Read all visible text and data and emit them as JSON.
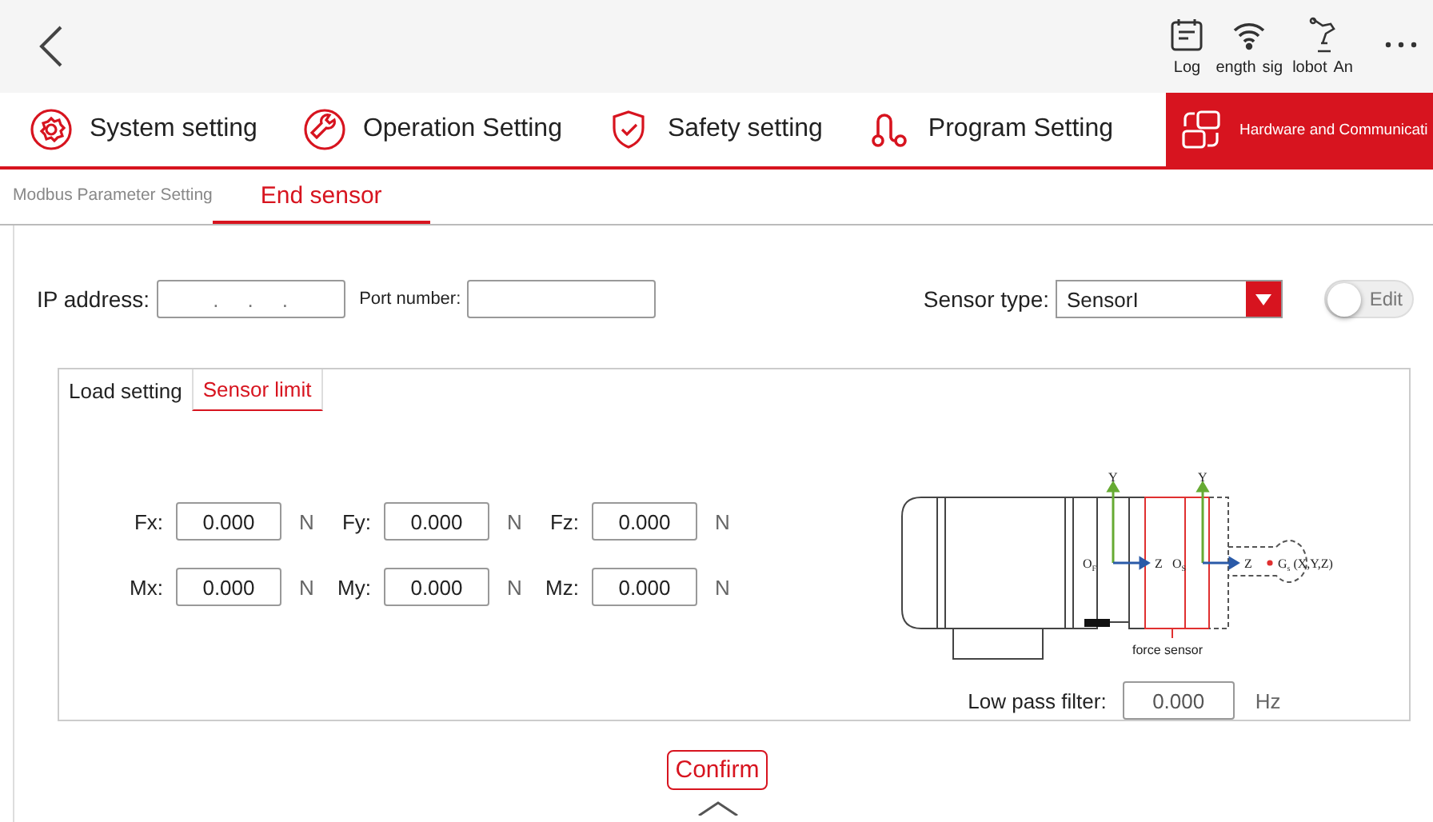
{
  "top_bar": {
    "status_items": [
      {
        "kind": "log",
        "label": "Log"
      },
      {
        "kind": "wifi",
        "label": "ength"
      },
      {
        "kind": "signal",
        "label": "sig"
      },
      {
        "kind": "robot",
        "label": "lobot"
      },
      {
        "kind": "arm",
        "label": "An"
      }
    ]
  },
  "main_tabs": [
    {
      "kind": "gear",
      "label": "System setting",
      "selected": false
    },
    {
      "kind": "wrench",
      "label": "Operation Setting",
      "selected": false
    },
    {
      "kind": "shield",
      "label": "Safety setting",
      "selected": false
    },
    {
      "kind": "program",
      "label": "Program Setting",
      "selected": false
    },
    {
      "kind": "hardware",
      "label": "Hardware and Communicati",
      "selected": true
    }
  ],
  "sub_tabs": [
    {
      "label": "Modbus Parameter Setting",
      "selected": false
    },
    {
      "label": "End sensor",
      "selected": true
    }
  ],
  "connection": {
    "ip_label": "IP address:",
    "ip_value": ".     .     .",
    "port_label": "Port number:",
    "sensor_type_label": "Sensor type:",
    "sensor_type_value": "SensorI",
    "edit_toggle": {
      "label": "Edit",
      "on": false
    }
  },
  "panel_tabs": [
    {
      "label": "Load setting",
      "selected": false
    },
    {
      "label": "Sensor limit",
      "selected": true
    }
  ],
  "limits": [
    [
      {
        "label": "Fx:",
        "value": "0.000",
        "unit": "N"
      },
      {
        "label": "Fy:",
        "value": "0.000",
        "unit": "N"
      },
      {
        "label": "Fz:",
        "value": "0.000",
        "unit": "N"
      }
    ],
    [
      {
        "label": "Mx:",
        "value": "0.000",
        "unit": "N"
      },
      {
        "label": "My:",
        "value": "0.000",
        "unit": "N"
      },
      {
        "label": "Mz:",
        "value": "0.000",
        "unit": "N"
      }
    ]
  ],
  "diagram": {
    "axis_y": [
      "Y",
      "Y"
    ],
    "axis_z": [
      "Z",
      "Z"
    ],
    "origins": [
      {
        "main": "O",
        "sub": "F"
      },
      {
        "main": "O",
        "sub": "S"
      }
    ],
    "point": {
      "main": "G",
      "sub": "s",
      "rest": " (X,Y,Z)"
    },
    "caption": "force sensor"
  },
  "low_pass": {
    "label": "Low pass filter:",
    "value": "0.000",
    "unit": "Hz"
  },
  "confirm_button": "Confirm"
}
